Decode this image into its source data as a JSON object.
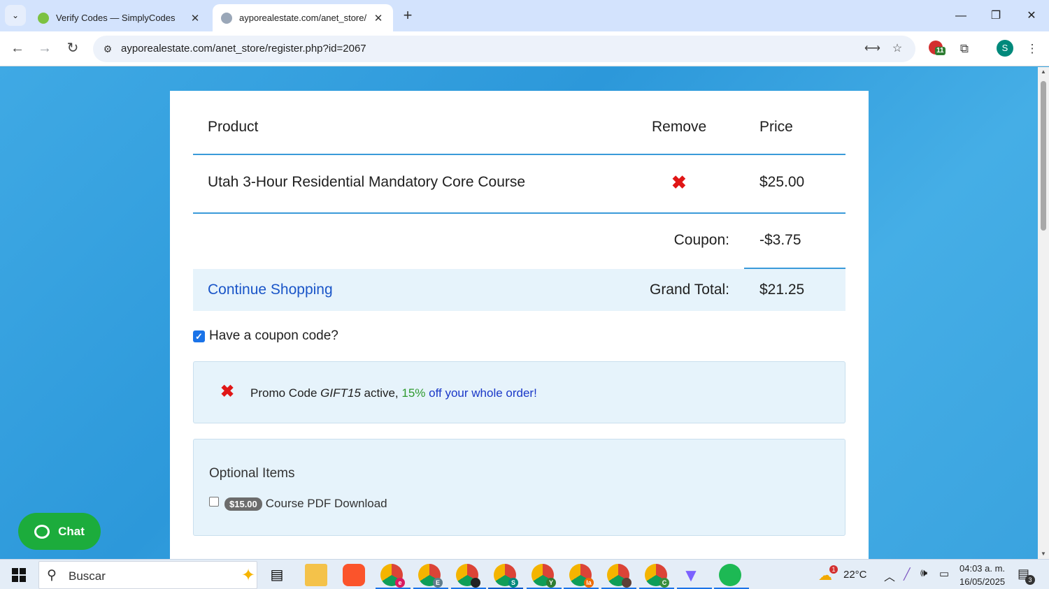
{
  "browser": {
    "tabs": [
      {
        "title": "Verify Codes — SimplyCodes",
        "active": false
      },
      {
        "title": "ayporealestate.com/anet_store/",
        "active": true
      }
    ],
    "new_tab": "+",
    "url": "ayporealestate.com/anet_store/register.php?id=2067",
    "extension_badge": "11",
    "profile_initial": "S",
    "window_controls": {
      "minimize": "—",
      "restore": "❐",
      "close": "✕"
    }
  },
  "cart": {
    "headers": {
      "product": "Product",
      "remove": "Remove",
      "price": "Price"
    },
    "items": [
      {
        "name": "Utah 3-Hour Residential Mandatory Core Course",
        "remove": "✖",
        "price": "$25.00"
      }
    ],
    "coupon_label": "Coupon:",
    "coupon_value": "-$3.75",
    "continue_shopping": "Continue Shopping",
    "grand_total_label": "Grand Total:",
    "grand_total_value": "$21.25"
  },
  "coupon_toggle": {
    "label": "Have a coupon code?",
    "checked": true
  },
  "promo": {
    "remove": "✖",
    "prefix": "Promo Code ",
    "code": "GIFT15",
    "middle": " active, ",
    "percent": "15%",
    "suffix": " off your whole order!"
  },
  "optional_items": {
    "title": "Optional Items",
    "items": [
      {
        "price": "$15.00",
        "label": "Course PDF Download",
        "checked": false
      }
    ]
  },
  "chat": {
    "label": "Chat"
  },
  "taskbar": {
    "search_placeholder": "Buscar",
    "weather": "22°C",
    "weather_alert": "1",
    "time": "04:03 a. m.",
    "date": "16/05/2025",
    "notifications": "3",
    "apps": [
      {
        "name": "task-view-icon"
      },
      {
        "name": "file-explorer-icon"
      },
      {
        "name": "brave-icon"
      },
      {
        "name": "chrome-profile-e-icon",
        "badge": "e"
      },
      {
        "name": "chrome-profile-E-icon",
        "badge": "E"
      },
      {
        "name": "chrome-profile-dark-icon",
        "badge": ""
      },
      {
        "name": "chrome-profile-s-icon",
        "badge": "S"
      },
      {
        "name": "chrome-profile-y-icon",
        "badge": "Y"
      },
      {
        "name": "chrome-profile-la-icon",
        "badge": "la"
      },
      {
        "name": "chrome-profile-photo-icon",
        "badge": ""
      },
      {
        "name": "chrome-profile-c-icon",
        "badge": "C"
      },
      {
        "name": "vpn-icon"
      },
      {
        "name": "spotify-icon"
      }
    ]
  },
  "colors": {
    "accent": "#3a9ad9",
    "remove_red": "#e01616",
    "link_blue": "#1a55c8",
    "chat_green": "#1cac3c",
    "page_bg": "#3aa6e0"
  }
}
